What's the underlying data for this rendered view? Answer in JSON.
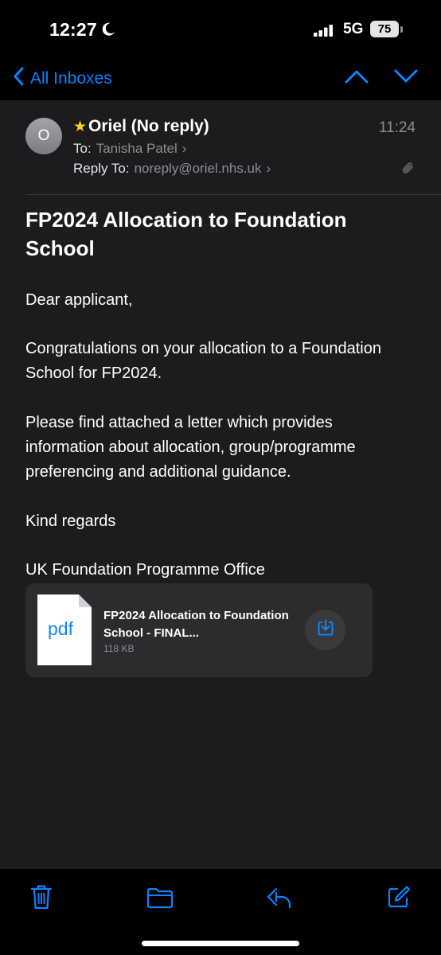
{
  "status_bar": {
    "time": "12:27",
    "network": "5G",
    "battery": "75"
  },
  "nav": {
    "back_label": "All Inboxes"
  },
  "email": {
    "avatar_initial": "O",
    "sender": "Oriel (No reply)",
    "time": "11:24",
    "to_label": "To:",
    "to_value": "Tanisha Patel",
    "reply_to_label": "Reply To:",
    "reply_to_value": "noreply@oriel.nhs.uk",
    "subject": "FP2024 Allocation to Foundation School",
    "body": {
      "greeting": "Dear applicant,",
      "para1": "Congratulations on your allocation to a Foundation School for FP2024.",
      "para2": "Please find attached a letter which provides information about allocation, group/programme preferencing and additional guidance.",
      "closing": "Kind regards",
      "signature": "UK Foundation Programme Office"
    },
    "attachment": {
      "icon_text": "pdf",
      "name": "FP2024 Allocation to Foundation School - FINAL...",
      "size": "118 KB"
    }
  },
  "colors": {
    "accent": "#0a84ff",
    "star": "#ffd60a",
    "background": "#1c1c1e",
    "bar_background": "#000000"
  },
  "icons": [
    "moon-icon",
    "cellular-signal-icon",
    "back-chevron-icon",
    "previous-message-icon",
    "next-message-icon",
    "star-icon",
    "paperclip-icon",
    "download-icon",
    "trash-icon",
    "folder-icon",
    "reply-icon",
    "compose-icon"
  ]
}
